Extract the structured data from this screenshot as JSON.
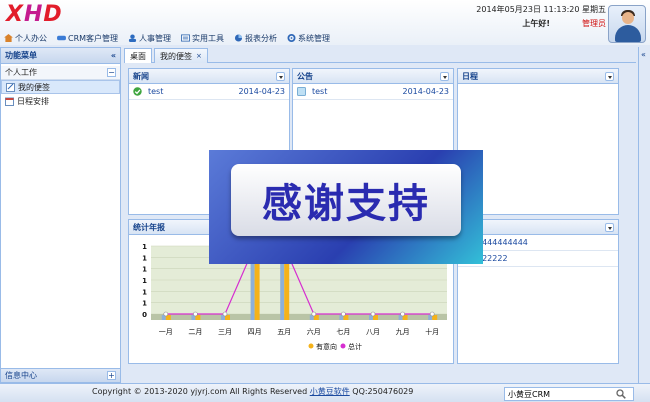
{
  "header": {
    "logo": "XHD",
    "datetime": "2014年05月23日 11:13:20 星期五",
    "greeting": "上午好!",
    "role": "管理员"
  },
  "nav": [
    {
      "label": "个人办公",
      "icon": "home-icon"
    },
    {
      "label": "CRM客户管理",
      "icon": "crm-icon"
    },
    {
      "label": "人事管理",
      "icon": "people-icon"
    },
    {
      "label": "实用工具",
      "icon": "tools-icon"
    },
    {
      "label": "报表分析",
      "icon": "report-icon"
    },
    {
      "label": "系统管理",
      "icon": "system-icon"
    }
  ],
  "sidebar": {
    "title": "功能菜单",
    "section": "个人工作",
    "items": [
      {
        "label": "我的便签",
        "icon": "note-icon"
      },
      {
        "label": "日程安排",
        "icon": "calendar-icon"
      }
    ],
    "footer": "信息中心"
  },
  "tabs": [
    {
      "label": "桌面"
    },
    {
      "label": "我的便签"
    }
  ],
  "panels": {
    "news": {
      "title": "新闻",
      "rows": [
        {
          "text": "test",
          "date": "2014-04-23"
        }
      ]
    },
    "notice": {
      "title": "公告",
      "rows": [
        {
          "text": "test",
          "date": "2014-04-23"
        }
      ]
    },
    "schedule": {
      "title": "日程"
    },
    "stats": {
      "title": "统计年报"
    },
    "notes": {
      "rows": [
        {
          "text": "4444444444"
        },
        {
          "text": "222222"
        }
      ]
    }
  },
  "overlay": {
    "text": "感谢支持"
  },
  "footer": {
    "copyright": "Copyright © 2013-2020 yjyrj.com All Rights Reserved",
    "link": "小黄豆软件",
    "qq": "QQ:250476029",
    "search_value": "小黄豆CRM"
  },
  "chart_data": {
    "type": "line",
    "categories": [
      "一月",
      "二月",
      "三月",
      "四月",
      "五月",
      "六月",
      "七月",
      "八月",
      "九月",
      "十月"
    ],
    "yticks": [
      0,
      1,
      1,
      1,
      1,
      1,
      1
    ],
    "series": [
      {
        "name": "有意向",
        "color": "#f5b21a",
        "values": [
          0,
          0,
          0,
          1,
          1,
          0,
          0,
          0,
          0,
          0
        ]
      },
      {
        "name": "总计",
        "color": "#d62ed0",
        "values": [
          0,
          0,
          0,
          1,
          1,
          0,
          0,
          0,
          0,
          0
        ]
      }
    ]
  }
}
